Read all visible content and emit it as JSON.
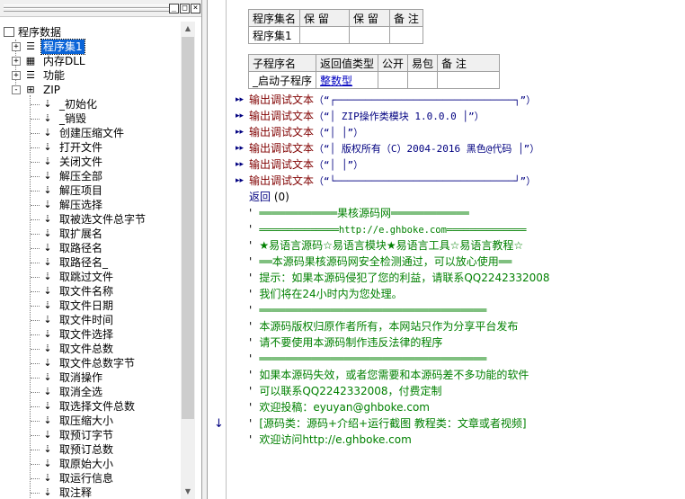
{
  "tree": {
    "root": "程序数据",
    "groups": [
      {
        "label": "程序集1",
        "selected": true,
        "sign": "+",
        "icon": "assembly-icon"
      },
      {
        "label": "内存DLL",
        "sign": "+",
        "icon": "dll-icon"
      },
      {
        "label": "功能",
        "sign": "+",
        "icon": "function-icon"
      },
      {
        "label": "ZIP",
        "sign": "-",
        "icon": "class-icon"
      }
    ],
    "methods": [
      "_初始化",
      "_销毁",
      "创建压缩文件",
      "打开文件",
      "关闭文件",
      "解压全部",
      "解压项目",
      "解压选择",
      "取被选文件总字节",
      "取扩展名",
      "取路径名",
      "取路径名_",
      "取跳过文件",
      "取文件名称",
      "取文件日期",
      "取文件时间",
      "取文件选择",
      "取文件总数",
      "取文件总数字节",
      "取消操作",
      "取消全选",
      "取选择文件总数",
      "取压缩大小",
      "取预订字节",
      "取预订总数",
      "取原始大小",
      "取运行信息",
      "取注释"
    ],
    "win_buttons": [
      "_",
      "□",
      "×"
    ]
  },
  "assembly_table": {
    "headers": [
      "程序集名",
      "保 留",
      "保 留",
      "备 注"
    ],
    "row": [
      "程序集1",
      "",
      "",
      ""
    ]
  },
  "sub_table": {
    "headers": [
      "子程序名",
      "返回值类型",
      "公开",
      "易包",
      "备 注"
    ],
    "row": [
      "_启动子程序",
      "整数型",
      "",
      "",
      ""
    ]
  },
  "debug_func": "输出调试文本",
  "debug_lines": [
    "（“┌──────────────────────────────┐”）",
    "（“│         ZIP操作类模块 1.0.0.0        │”）",
    "（“│                              │”）",
    "（“│   版权所有（C）2004-2016 黑色@代码   │”）",
    "（“│                              │”）",
    "（“└──────────────────────────────┘”）"
  ],
  "return_stmt": {
    "keyword": "返回",
    "value": "(0)"
  },
  "comment_mark": "'",
  "comments": [
    {
      "text": "════════════果核源码网════════════",
      "mono": false
    },
    {
      "text": "══════════════http://e.ghboke.com══════════════",
      "mono": true
    },
    {
      "text": "★易语言源码☆易语言模块★易语言工具☆易语言教程☆",
      "mono": false
    },
    {
      "text": "══本源码果核源码网安全检测通过，可以放心使用══",
      "mono": false
    },
    {
      "text": "提示：如果本源码侵犯了您的利益，请联系QQ2242332008",
      "mono": false
    },
    {
      "text": "我们将在24小时内为您处理。",
      "mono": false
    },
    {
      "text": "═══════════════════════════════════",
      "mono": false
    },
    {
      "text": "本源码版权归原作者所有，本网站只作为分享平台发布",
      "mono": false
    },
    {
      "text": "请不要使用本源码制作违反法律的程序",
      "mono": false
    },
    {
      "text": "═══════════════════════════════════",
      "mono": false
    },
    {
      "text": "如果本源码失效，或者您需要和本源码差不多功能的软件",
      "mono": false
    },
    {
      "text": "可以联系QQ2242332008，付费定制",
      "mono": false
    },
    {
      "text": "欢迎投稿：eyuyan@ghboke.com",
      "mono": false
    },
    {
      "text": "[源码类：源码+介绍+运行截图 教程类：文章或者视频]",
      "mono": false
    },
    {
      "text": "欢迎访问http://e.ghboke.com",
      "mono": false
    }
  ],
  "gutter_arrow": "↓",
  "colors": {
    "selection": "#0a64d8",
    "function": "#800000",
    "string": "#000080",
    "comment": "#008000"
  }
}
